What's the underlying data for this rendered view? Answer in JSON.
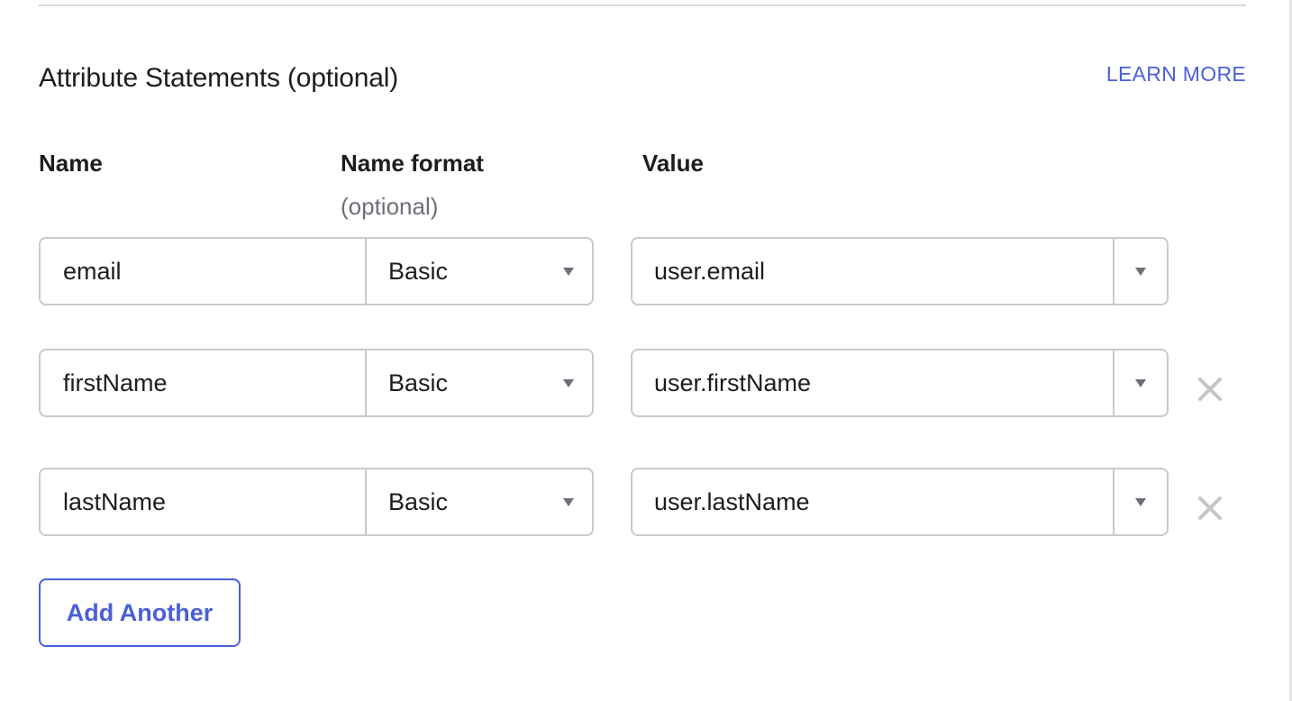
{
  "section": {
    "title": "Attribute Statements (optional)",
    "learn_more": "LEARN MORE"
  },
  "columns": {
    "name": "Name",
    "name_format": "Name format",
    "name_format_sub": "(optional)",
    "value": "Value"
  },
  "rows": [
    {
      "name": "email",
      "format": "Basic",
      "value": "user.email",
      "removable": false
    },
    {
      "name": "firstName",
      "format": "Basic",
      "value": "user.firstName",
      "removable": true
    },
    {
      "name": "lastName",
      "format": "Basic",
      "value": "user.lastName",
      "removable": true
    }
  ],
  "actions": {
    "add_another": "Add Another"
  },
  "icons": {
    "caret": "caret-down-icon",
    "remove": "close-icon"
  },
  "colors": {
    "accent": "#4a5fd9",
    "border": "#c9c9cf",
    "muted_text": "#6e6e78",
    "remove_icon": "#c4c4c9"
  }
}
